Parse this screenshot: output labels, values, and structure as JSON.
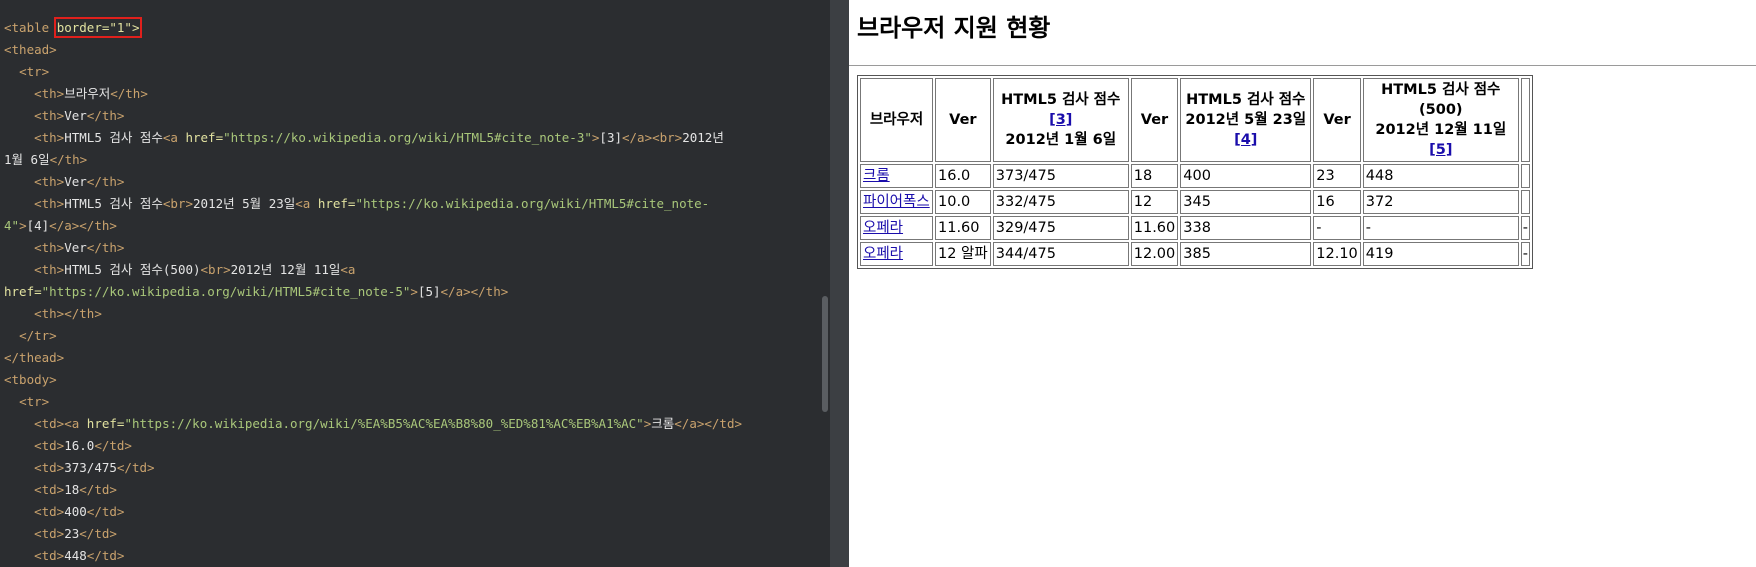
{
  "editor": {
    "lines": [
      [
        [
          "tag",
          "<table "
        ],
        [
          "attr_hl",
          "border=\"1\">"
        ]
      ],
      [
        [
          "tag",
          "<thead>"
        ]
      ],
      [
        [
          "txt",
          "  "
        ],
        [
          "tag",
          "<tr>"
        ]
      ],
      [
        [
          "txt",
          "    "
        ],
        [
          "tag",
          "<th>"
        ],
        [
          "txt",
          "브라우저"
        ],
        [
          "tag",
          "</th>"
        ]
      ],
      [
        [
          "txt",
          "    "
        ],
        [
          "tag",
          "<th>"
        ],
        [
          "txt",
          "Ver"
        ],
        [
          "tag",
          "</th>"
        ]
      ],
      [
        [
          "txt",
          "    "
        ],
        [
          "tag",
          "<th>"
        ],
        [
          "txt",
          "HTML5 검사 점수"
        ],
        [
          "tag",
          "<a "
        ],
        [
          "attr",
          "href="
        ],
        [
          "str",
          "\"https://ko.wikipedia.org/wiki/HTML5#cite_note-3\""
        ],
        [
          "tag",
          ">"
        ],
        [
          "txt",
          "[3]"
        ],
        [
          "tag",
          "</a><br>"
        ],
        [
          "txt",
          "2012년"
        ]
      ],
      [
        [
          "txt",
          "1월 6일"
        ],
        [
          "tag",
          "</th>"
        ]
      ],
      [
        [
          "txt",
          "    "
        ],
        [
          "tag",
          "<th>"
        ],
        [
          "txt",
          "Ver"
        ],
        [
          "tag",
          "</th>"
        ]
      ],
      [
        [
          "txt",
          "    "
        ],
        [
          "tag",
          "<th>"
        ],
        [
          "txt",
          "HTML5 검사 점수"
        ],
        [
          "tag",
          "<br>"
        ],
        [
          "txt",
          "2012년 5월 23일"
        ],
        [
          "tag",
          "<a "
        ],
        [
          "attr",
          "href="
        ],
        [
          "str",
          "\"https://ko.wikipedia.org/wiki/HTML5#cite_note-"
        ]
      ],
      [
        [
          "str",
          "4\""
        ],
        [
          "tag",
          ">"
        ],
        [
          "txt",
          "[4]"
        ],
        [
          "tag",
          "</a></th>"
        ]
      ],
      [
        [
          "txt",
          "    "
        ],
        [
          "tag",
          "<th>"
        ],
        [
          "txt",
          "Ver"
        ],
        [
          "tag",
          "</th>"
        ]
      ],
      [
        [
          "txt",
          "    "
        ],
        [
          "tag",
          "<th>"
        ],
        [
          "txt",
          "HTML5 검사 점수(500)"
        ],
        [
          "tag",
          "<br>"
        ],
        [
          "txt",
          "2012년 12월 11일"
        ],
        [
          "tag",
          "<a"
        ]
      ],
      [
        [
          "attr",
          "href="
        ],
        [
          "str",
          "\"https://ko.wikipedia.org/wiki/HTML5#cite_note-5\""
        ],
        [
          "tag",
          ">"
        ],
        [
          "txt",
          "[5]"
        ],
        [
          "tag",
          "</a></th>"
        ]
      ],
      [
        [
          "txt",
          "    "
        ],
        [
          "tag",
          "<th></th>"
        ]
      ],
      [
        [
          "txt",
          "  "
        ],
        [
          "tag",
          "</tr>"
        ]
      ],
      [
        [
          "tag",
          "</thead>"
        ]
      ],
      [
        [
          "tag",
          "<tbody>"
        ]
      ],
      [
        [
          "txt",
          "  "
        ],
        [
          "tag",
          "<tr>"
        ]
      ],
      [
        [
          "txt",
          "    "
        ],
        [
          "tag",
          "<td><a "
        ],
        [
          "attr",
          "href="
        ],
        [
          "str",
          "\"https://ko.wikipedia.org/wiki/%EA%B5%AC%EA%B8%80_%ED%81%AC%EB%A1%AC\""
        ],
        [
          "tag",
          ">"
        ],
        [
          "txt",
          "크롬"
        ],
        [
          "tag",
          "</a></td>"
        ]
      ],
      [
        [
          "txt",
          "    "
        ],
        [
          "tag",
          "<td>"
        ],
        [
          "txt",
          "16.0"
        ],
        [
          "tag",
          "</td>"
        ]
      ],
      [
        [
          "txt",
          "    "
        ],
        [
          "tag",
          "<td>"
        ],
        [
          "txt",
          "373/475"
        ],
        [
          "tag",
          "</td>"
        ]
      ],
      [
        [
          "txt",
          "    "
        ],
        [
          "tag",
          "<td>"
        ],
        [
          "txt",
          "18"
        ],
        [
          "tag",
          "</td>"
        ]
      ],
      [
        [
          "txt",
          "    "
        ],
        [
          "tag",
          "<td>"
        ],
        [
          "txt",
          "400"
        ],
        [
          "tag",
          "</td>"
        ]
      ],
      [
        [
          "txt",
          "    "
        ],
        [
          "tag",
          "<td>"
        ],
        [
          "txt",
          "23"
        ],
        [
          "tag",
          "</td>"
        ]
      ],
      [
        [
          "txt",
          "    "
        ],
        [
          "tag",
          "<td>"
        ],
        [
          "txt",
          "448"
        ],
        [
          "tag",
          "</td>"
        ]
      ]
    ]
  },
  "preview": {
    "title": "브라우저 지원 현황",
    "headers": {
      "browser": "브라우저",
      "ver1": "Ver",
      "score1_line1": "HTML5 검사 점수",
      "score1_ref": "[3]",
      "score1_line2": "2012년 1월 6일",
      "ver2": "Ver",
      "score2_line1": "HTML5 검사 점수",
      "score2_line2": "2012년 5월 23일",
      "score2_ref": "[4]",
      "ver3": "Ver",
      "score3_line1": "HTML5 검사 점수(500)",
      "score3_line2": "2012년 12월 11일",
      "score3_ref": "[5]",
      "extra": ""
    },
    "rows": [
      {
        "browser": "크롬",
        "ver1": "16.0",
        "score1": "373/475",
        "ver2": "18",
        "score2": "400",
        "ver3": "23",
        "score3": "448",
        "extra": ""
      },
      {
        "browser": "파이어폭스",
        "ver1": "10.0",
        "score1": "332/475",
        "ver2": "12",
        "score2": "345",
        "ver3": "16",
        "score3": "372",
        "extra": ""
      },
      {
        "browser": "오페라",
        "ver1": "11.60",
        "score1": "329/475",
        "ver2": "11.60",
        "score2": "338",
        "ver3": "-",
        "score3": "-",
        "extra": "-"
      },
      {
        "browser": "오페라",
        "ver1": "12 알파",
        "score1": "344/475",
        "ver2": "12.00",
        "score2": "385",
        "ver3": "12.10",
        "score3": "419",
        "extra": "-"
      }
    ]
  }
}
